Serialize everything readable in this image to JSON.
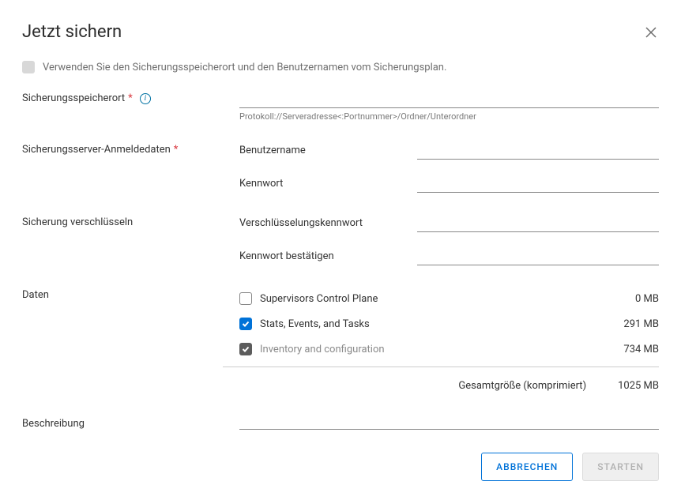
{
  "dialog": {
    "title": "Jetzt sichern"
  },
  "useSchedule": {
    "label": "Verwenden Sie den Sicherungsspeicherort und den Benutzernamen vom Sicherungsplan."
  },
  "location": {
    "label": "Sicherungsspeicherort",
    "helper": "Protokoll://Serveradresse<:Portnummer>/Ordner/Unterordner",
    "value": ""
  },
  "credentials": {
    "label": "Sicherungsserver-Anmeldedaten",
    "username_label": "Benutzername",
    "username_value": "",
    "password_label": "Kennwort",
    "password_value": ""
  },
  "encryption": {
    "label": "Sicherung verschlüsseln",
    "password_label": "Verschlüsselungskennwort",
    "password_value": "",
    "confirm_label": "Kennwort bestätigen",
    "confirm_value": ""
  },
  "data": {
    "label": "Daten",
    "items": [
      {
        "label": "Supervisors Control Plane",
        "size": "0 MB",
        "checked": false,
        "enabled": true
      },
      {
        "label": "Stats, Events, and Tasks",
        "size": "291 MB",
        "checked": true,
        "enabled": true
      },
      {
        "label": "Inventory and configuration",
        "size": "734 MB",
        "checked": true,
        "enabled": false
      }
    ],
    "total_label": "Gesamtgröße (komprimiert)",
    "total_value": "1025 MB"
  },
  "description": {
    "label": "Beschreibung",
    "value": ""
  },
  "buttons": {
    "cancel": "ABBRECHEN",
    "start": "STARTEN"
  }
}
